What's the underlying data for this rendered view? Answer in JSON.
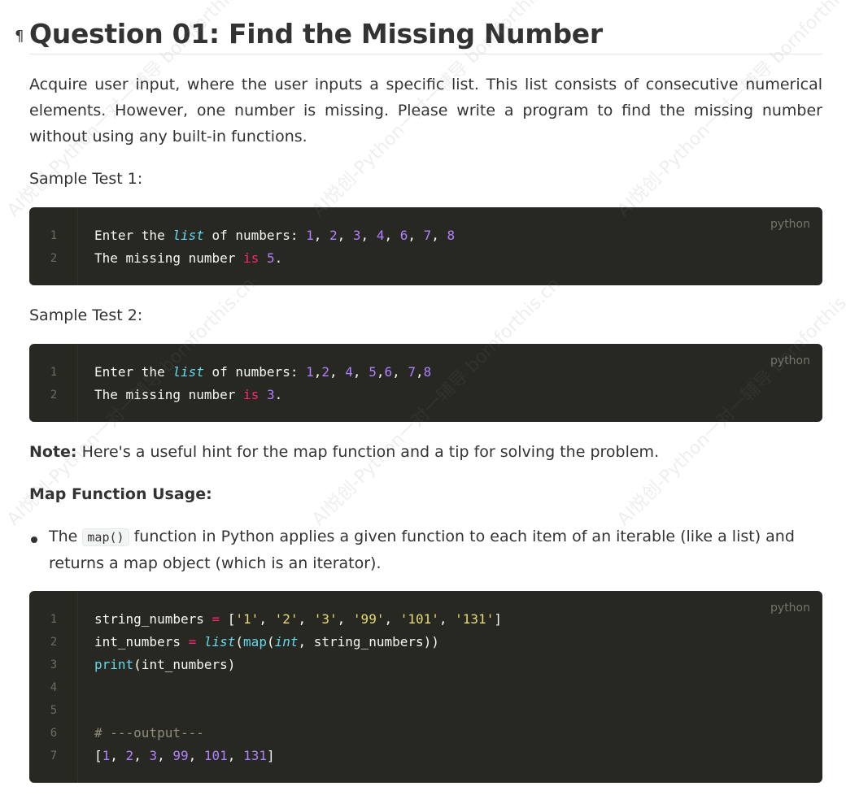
{
  "heading": {
    "pilcrow": "¶",
    "title": "Question 01: Find the Missing Number"
  },
  "intro": "Acquire user input, where the user inputs a specific list. This list consists of consecutive numerical elements. However, one number is missing. Please write a program to find the missing number without using any built-in functions.",
  "sample1": {
    "label": "Sample Test 1:",
    "lang": "python",
    "line_numbers": [
      "1",
      "2"
    ],
    "line1": [
      {
        "t": "Enter the ",
        "c": "plain"
      },
      {
        "t": "list",
        "c": "builtin-it"
      },
      {
        "t": " of numbers: ",
        "c": "plain"
      },
      {
        "t": "1",
        "c": "num"
      },
      {
        "t": ", ",
        "c": "plain"
      },
      {
        "t": "2",
        "c": "num"
      },
      {
        "t": ", ",
        "c": "plain"
      },
      {
        "t": "3",
        "c": "num"
      },
      {
        "t": ", ",
        "c": "plain"
      },
      {
        "t": "4",
        "c": "num"
      },
      {
        "t": ", ",
        "c": "plain"
      },
      {
        "t": "6",
        "c": "num"
      },
      {
        "t": ", ",
        "c": "plain"
      },
      {
        "t": "7",
        "c": "num"
      },
      {
        "t": ", ",
        "c": "plain"
      },
      {
        "t": "8",
        "c": "num"
      }
    ],
    "line2": [
      {
        "t": "The missing number ",
        "c": "plain"
      },
      {
        "t": "is",
        "c": "kw"
      },
      {
        "t": " ",
        "c": "plain"
      },
      {
        "t": "5",
        "c": "num"
      },
      {
        "t": ".",
        "c": "plain"
      }
    ]
  },
  "sample2": {
    "label": "Sample Test 2:",
    "lang": "python",
    "line_numbers": [
      "1",
      "2"
    ],
    "line1": [
      {
        "t": "Enter the ",
        "c": "plain"
      },
      {
        "t": "list",
        "c": "builtin-it"
      },
      {
        "t": " of numbers: ",
        "c": "plain"
      },
      {
        "t": "1",
        "c": "num"
      },
      {
        "t": ",",
        "c": "plain"
      },
      {
        "t": "2",
        "c": "num"
      },
      {
        "t": ", ",
        "c": "plain"
      },
      {
        "t": "4",
        "c": "num"
      },
      {
        "t": ", ",
        "c": "plain"
      },
      {
        "t": "5",
        "c": "num"
      },
      {
        "t": ",",
        "c": "plain"
      },
      {
        "t": "6",
        "c": "num"
      },
      {
        "t": ", ",
        "c": "plain"
      },
      {
        "t": "7",
        "c": "num"
      },
      {
        "t": ",",
        "c": "plain"
      },
      {
        "t": "8",
        "c": "num"
      }
    ],
    "line2": [
      {
        "t": "The missing number ",
        "c": "plain"
      },
      {
        "t": "is",
        "c": "kw"
      },
      {
        "t": " ",
        "c": "plain"
      },
      {
        "t": "3",
        "c": "num"
      },
      {
        "t": ".",
        "c": "plain"
      }
    ]
  },
  "note": {
    "label": "Note:",
    "text": " Here's a useful hint for the map function and a tip for solving the problem."
  },
  "map_heading": "Map Function Usage:",
  "bullet": {
    "before": "The ",
    "code": "map()",
    "after": " function in Python applies a given function to each item of an iterable (like a list) and returns a map object (which is an iterator)."
  },
  "code3": {
    "lang": "python",
    "line_numbers": [
      "1",
      "2",
      "3",
      "4",
      "5",
      "6",
      "7"
    ],
    "line1": [
      {
        "t": "string_numbers ",
        "c": "plain"
      },
      {
        "t": "=",
        "c": "op"
      },
      {
        "t": " [",
        "c": "plain"
      },
      {
        "t": "'1'",
        "c": "str"
      },
      {
        "t": ", ",
        "c": "plain"
      },
      {
        "t": "'2'",
        "c": "str"
      },
      {
        "t": ", ",
        "c": "plain"
      },
      {
        "t": "'3'",
        "c": "str"
      },
      {
        "t": ", ",
        "c": "plain"
      },
      {
        "t": "'99'",
        "c": "str"
      },
      {
        "t": ", ",
        "c": "plain"
      },
      {
        "t": "'101'",
        "c": "str"
      },
      {
        "t": ", ",
        "c": "plain"
      },
      {
        "t": "'131'",
        "c": "str"
      },
      {
        "t": "]",
        "c": "plain"
      }
    ],
    "line2": [
      {
        "t": "int_numbers ",
        "c": "plain"
      },
      {
        "t": "=",
        "c": "op"
      },
      {
        "t": " ",
        "c": "plain"
      },
      {
        "t": "list",
        "c": "builtin-it"
      },
      {
        "t": "(",
        "c": "plain"
      },
      {
        "t": "map",
        "c": "builtin"
      },
      {
        "t": "(",
        "c": "plain"
      },
      {
        "t": "int",
        "c": "builtin-it"
      },
      {
        "t": ", string_numbers))",
        "c": "plain"
      }
    ],
    "line3": [
      {
        "t": "print",
        "c": "builtin"
      },
      {
        "t": "(int_numbers)",
        "c": "plain"
      }
    ],
    "line4": [],
    "line5": [],
    "line6": [
      {
        "t": "# ---output---",
        "c": "comment"
      }
    ],
    "line7": [
      {
        "t": "[",
        "c": "plain"
      },
      {
        "t": "1",
        "c": "num"
      },
      {
        "t": ", ",
        "c": "plain"
      },
      {
        "t": "2",
        "c": "num"
      },
      {
        "t": ", ",
        "c": "plain"
      },
      {
        "t": "3",
        "c": "num"
      },
      {
        "t": ", ",
        "c": "plain"
      },
      {
        "t": "99",
        "c": "num"
      },
      {
        "t": ", ",
        "c": "plain"
      },
      {
        "t": "101",
        "c": "num"
      },
      {
        "t": ", ",
        "c": "plain"
      },
      {
        "t": "131",
        "c": "num"
      },
      {
        "t": "]",
        "c": "plain"
      }
    ]
  },
  "watermark": "AI悦创-Python一对一辅导 bornforthis.cn"
}
